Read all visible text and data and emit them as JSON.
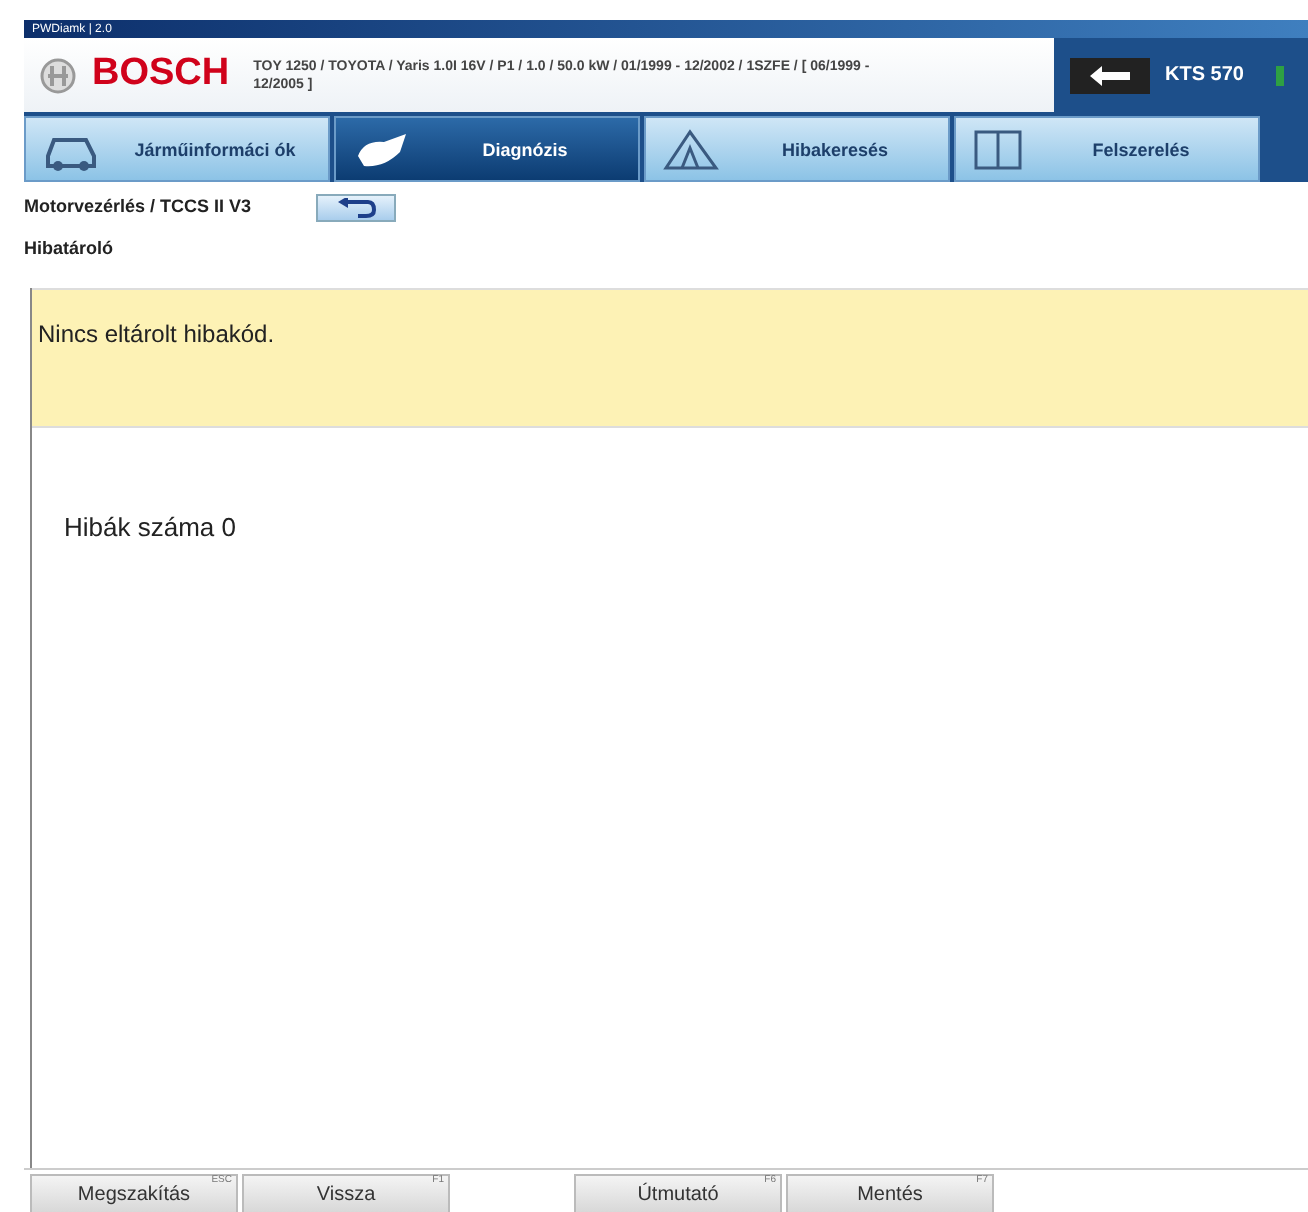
{
  "window": {
    "title": "PWDiamk | 2.0"
  },
  "header": {
    "brand": "BOSCH",
    "vehicle": "TOY 1250 / TOYOTA / Yaris 1.0I 16V / P1 / 1.0 / 50.0 kW / 01/1999 - 12/2002 / 1SZFE / [ 06/1999 - 12/2005 ]",
    "device": "KTS 570"
  },
  "tabs": [
    {
      "label": "Járműinformáci ók",
      "kind": "car",
      "selected": false
    },
    {
      "label": "Diagnózis",
      "kind": "plug",
      "selected": true
    },
    {
      "label": "Hibakeresés",
      "kind": "triangle",
      "selected": false
    },
    {
      "label": "Felszerelés",
      "kind": "book",
      "selected": false
    }
  ],
  "breadcrumb": "Motorvezérlés / TCCS II V3",
  "section_title": "Hibatároló",
  "message": "Nincs eltárolt hibakód.",
  "fault_count": "Hibák száma 0",
  "buttons": [
    {
      "label": "Megszakítás",
      "hotkey": "ESC"
    },
    {
      "label": "Vissza",
      "hotkey": "F1"
    },
    {
      "label": "Útmutató",
      "hotkey": "F6"
    },
    {
      "label": "Mentés",
      "hotkey": "F7"
    }
  ]
}
